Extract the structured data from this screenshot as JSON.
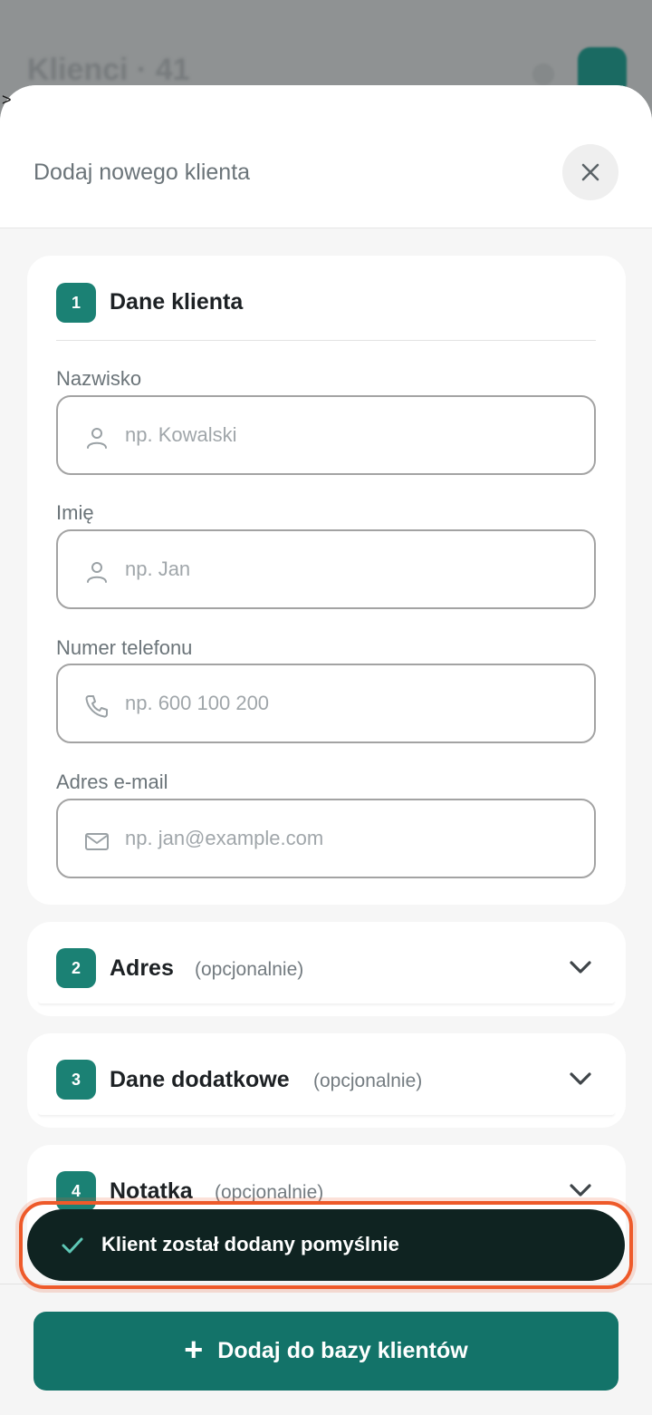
{
  "background": {
    "title": "Klienci · 41"
  },
  "sheet": {
    "title": "Dodaj nowego klienta",
    "close_icon": "close-icon"
  },
  "sections": [
    {
      "number": "1",
      "title": "Dane klienta",
      "expanded": true,
      "fields": [
        {
          "label": "Nazwisko",
          "placeholder": "np. Kowalski",
          "icon": "person-icon"
        },
        {
          "label": "Imię",
          "placeholder": "np. Jan",
          "icon": "person-icon"
        },
        {
          "label": "Numer telefonu",
          "placeholder": "np. 600 100 200",
          "icon": "phone-icon"
        },
        {
          "label": "Adres e-mail",
          "placeholder": "np. jan@example.com",
          "icon": "mail-icon"
        }
      ]
    },
    {
      "number": "2",
      "title": "Adres",
      "optional": "(opcjonalnie)",
      "expanded": false
    },
    {
      "number": "3",
      "title": "Dane dodatkowe",
      "optional": "(opcjonalnie)",
      "expanded": false
    },
    {
      "number": "4",
      "title": "Notatka",
      "optional": "(opcjonalnie)",
      "expanded": false
    }
  ],
  "toast": {
    "message": "Klient został dodany pomyślnie",
    "icon": "check-icon"
  },
  "footer": {
    "button_label": "Dodaj do bazy klientów",
    "button_icon": "plus-icon"
  },
  "colors": {
    "accent": "#1b8174",
    "primary_button": "#137369",
    "toast_bg": "#0f2321",
    "highlight": "#ee5a2a"
  }
}
